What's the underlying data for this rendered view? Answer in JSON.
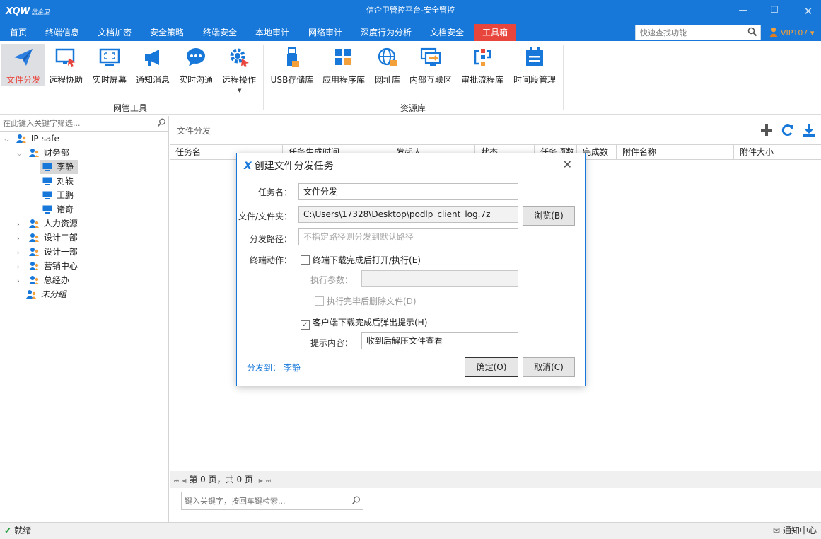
{
  "titlebar": {
    "logo_text": "XQW",
    "logo_sub": "信企卫",
    "title": "信企卫管控平台-安全管控"
  },
  "menu": {
    "items": [
      "首页",
      "终端信息",
      "文档加密",
      "安全策略",
      "终端安全",
      "本地审计",
      "网络审计",
      "深度行为分析",
      "文档安全",
      "工具箱"
    ],
    "active_index": 9,
    "quick_search_placeholder": "快速查找功能",
    "vip_label": "VIP107"
  },
  "ribbon": {
    "network_tools": [
      "文件分发",
      "远程协助",
      "实时屏幕",
      "通知消息",
      "实时沟通",
      "远程操作"
    ],
    "network_tools_group": "网管工具",
    "resources": [
      "USB存储库",
      "应用程序库",
      "网址库",
      "内部互联区",
      "审批流程库",
      "时间段管理"
    ],
    "resources_group": "资源库",
    "active": "文件分发"
  },
  "tree": {
    "filter_placeholder": "在此键入关键字筛选...",
    "root": "IP-safe",
    "dept_open": "财务部",
    "users": [
      "李静",
      "刘轶",
      "王鹏",
      "诸奇"
    ],
    "selected_user": "李静",
    "depts": [
      "人力资源",
      "设计二部",
      "设计一部",
      "营销中心",
      "总经办"
    ],
    "ungrouped": "未分组"
  },
  "pane": {
    "title": "文件分发",
    "columns": [
      "任务名",
      "任务生成时间",
      "发起人",
      "状态",
      "任务项数",
      "完成数",
      "附件名称",
      "附件大小"
    ],
    "pager": {
      "text": "第 0 页，共 0 页"
    },
    "search_placeholder": "键入关键字，按回车键检索..."
  },
  "dialog": {
    "title": "创建文件分发任务",
    "task_name_label": "任务名：",
    "task_name_value": "文件分发",
    "file_label": "文件/文件夹：",
    "file_value": "C:\\Users\\17328\\Desktop\\podlp_client_log.7z",
    "browse_label": "浏览(B)",
    "path_label": "分发路径：",
    "path_placeholder": "不指定路径则分发到默认路径",
    "action_label": "终端动作：",
    "open_after_download": {
      "label": "终端下载完成后打开/执行(E)",
      "checked": false
    },
    "exec_params_label": "执行参数：",
    "exec_params_value": "",
    "delete_after_exec": {
      "label": "执行完毕后删除文件(D)",
      "checked": false
    },
    "popup_prompt": {
      "label": "客户端下载完成后弹出提示(H)",
      "checked": true
    },
    "prompt_content_label": "提示内容：",
    "prompt_content_value": "收到后解压文件查看",
    "target_label": "分发到：",
    "target_value": "李静",
    "ok_label": "确定(O)",
    "cancel_label": "取消(C)"
  },
  "status": {
    "ready": "就绪",
    "notify_center": "通知中心"
  },
  "colors": {
    "brand": "#1778d9",
    "accent": "#e8453c",
    "vip": "#f3a03a"
  }
}
